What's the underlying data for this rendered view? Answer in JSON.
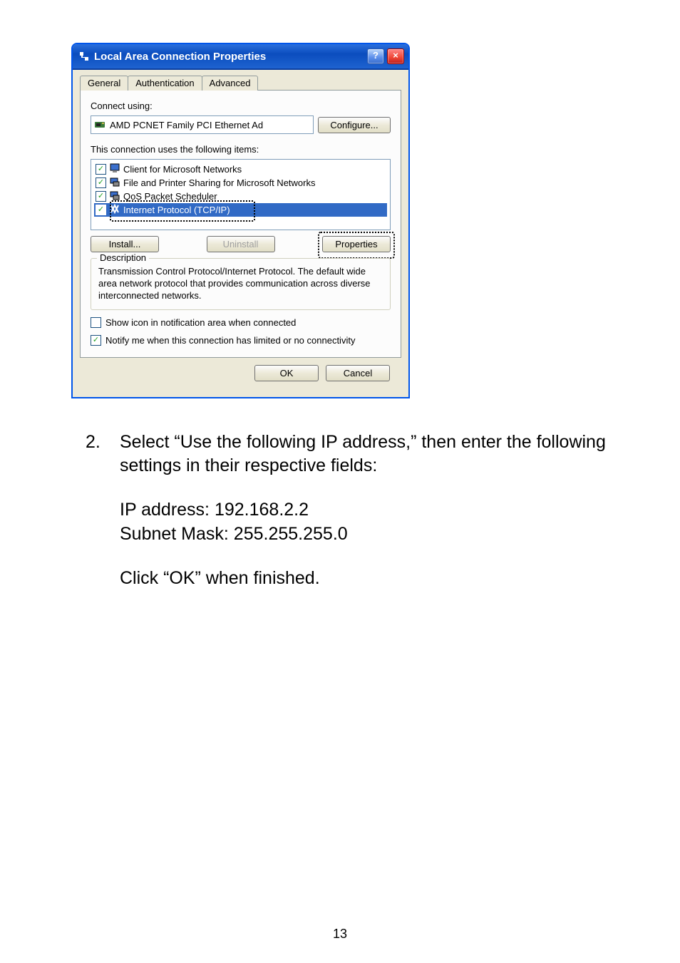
{
  "dialog": {
    "title": "Local Area Connection Properties",
    "tabs": {
      "general": "General",
      "auth": "Authentication",
      "adv": "Advanced"
    },
    "connect_using": "Connect using:",
    "adapter": "AMD PCNET Family PCI Ethernet Ad",
    "configure": "Configure...",
    "uses": "This connection uses the following items:",
    "items": {
      "client": "Client for Microsoft Networks",
      "fps": "File and Printer Sharing for Microsoft Networks",
      "qos": "QoS Packet Scheduler",
      "tcpip": "Internet Protocol (TCP/IP)"
    },
    "install": "Install...",
    "uninstall": "Uninstall",
    "properties": "Properties",
    "desc_legend": "Description",
    "desc_text": "Transmission Control Protocol/Internet Protocol. The default wide area network protocol that provides communication across diverse interconnected networks.",
    "show_icon": "Show icon in notification area when connected",
    "notify": "Notify me when this connection has limited or no connectivity",
    "ok": "OK",
    "cancel": "Cancel"
  },
  "instr": {
    "num": "2.",
    "text": "Select “Use the following IP address,” then enter the following settings in their respective fields:",
    "ip": "IP address: 192.168.2.2",
    "mask": "Subnet Mask: 255.255.255.0",
    "click": "Click “OK” when finished."
  },
  "page_number": "13"
}
